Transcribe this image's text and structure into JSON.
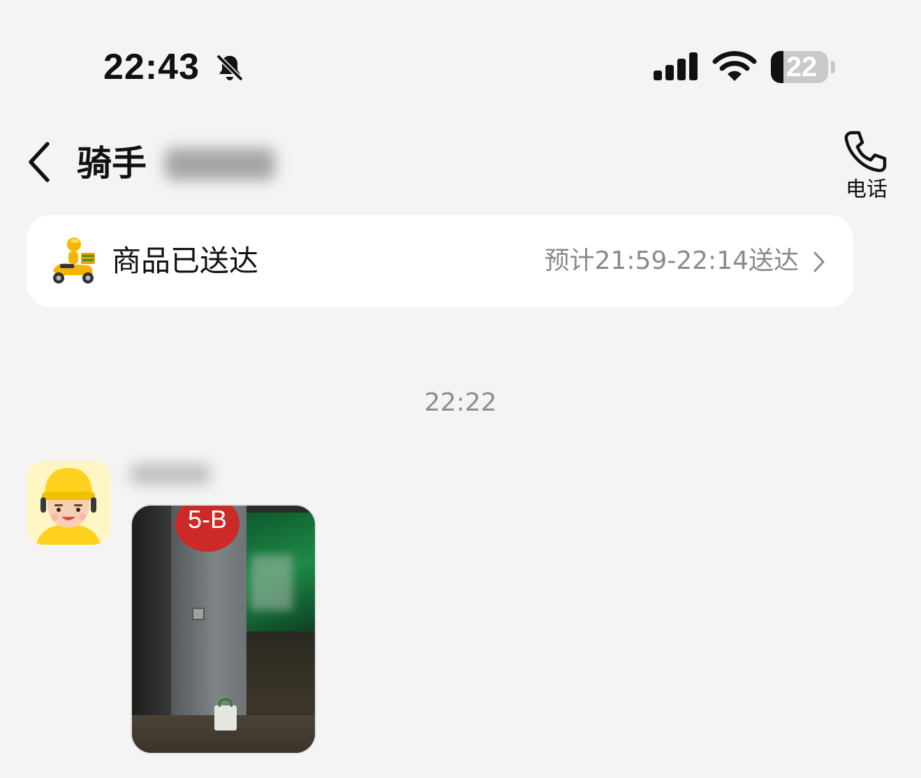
{
  "status_bar": {
    "time": "22:43",
    "battery_level": 22,
    "battery_text": "22",
    "silent_mode": true
  },
  "header": {
    "title": "骑手",
    "phone_label": "电话"
  },
  "delivery_card": {
    "status": "商品已送达",
    "eta": "预计21:59-22:14送达"
  },
  "conversation": {
    "timestamp": "22:22",
    "messages": [
      {
        "sender": "rider",
        "type": "image",
        "sign_text": "5-B"
      }
    ]
  },
  "colors": {
    "background": "#f4f4f4",
    "card": "#ffffff",
    "secondary_text": "#8a8a8a",
    "brand_yellow": "#ffd21f"
  }
}
